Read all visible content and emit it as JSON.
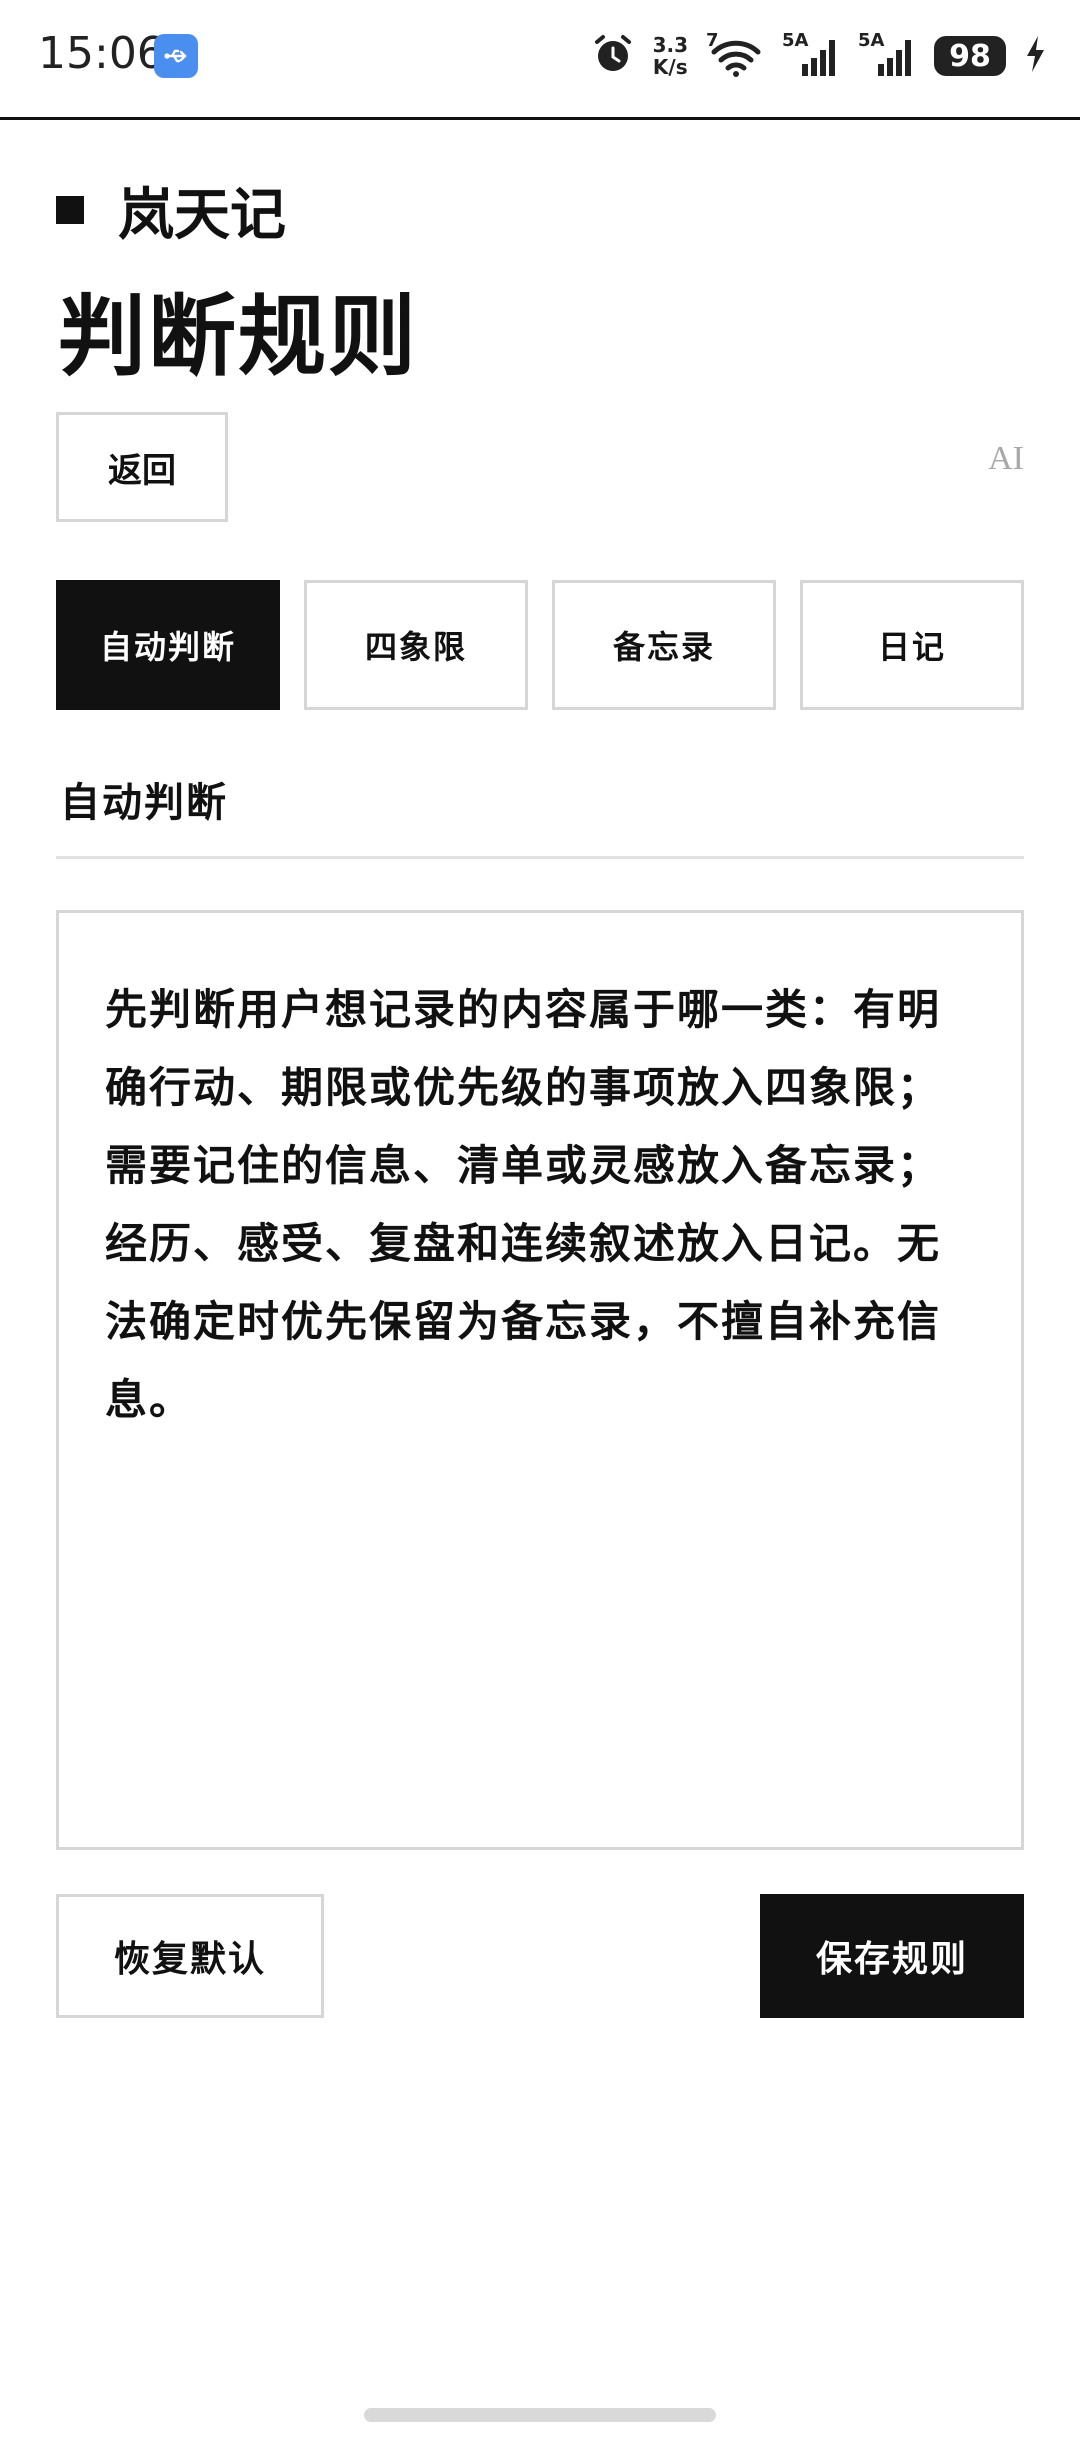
{
  "status_bar": {
    "time": "15:06",
    "usb_icon": "usb-icon",
    "net_speed_value": "3.3",
    "net_speed_unit": "K/s",
    "wifi_badge": "7",
    "signal1_label": "5A",
    "signal2_label": "5A",
    "battery": "98",
    "usb_color": "#4a8ff0"
  },
  "header": {
    "brand_name": "岚天记",
    "page_title": "判断规则",
    "back_label": "返回",
    "ai_label": "AI"
  },
  "tabs": [
    {
      "label": "自动判断",
      "active": true
    },
    {
      "label": "四象限",
      "active": false
    },
    {
      "label": "备忘录",
      "active": false
    },
    {
      "label": "日记",
      "active": false
    }
  ],
  "section": {
    "heading": "自动判断"
  },
  "editor": {
    "content": "先判断用户想记录的内容属于哪一类：有明确行动、期限或优先级的事项放入四象限；需要记住的信息、清单或灵感放入备忘录；经历、感受、复盘和连续叙述放入日记。无法确定时优先保留为备忘录，不擅自补充信息。"
  },
  "actions": {
    "reset_label": "恢复默认",
    "save_label": "保存规则"
  }
}
